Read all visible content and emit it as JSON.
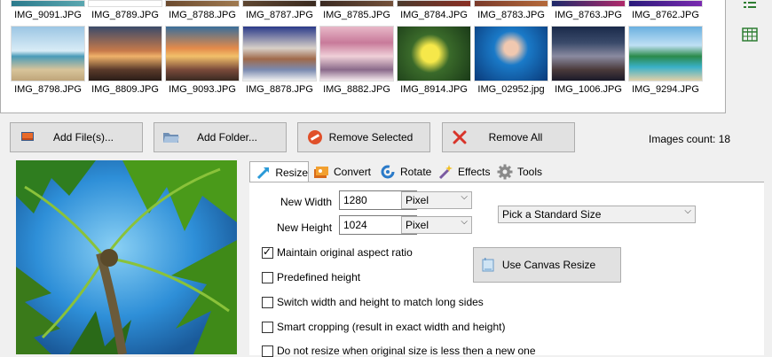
{
  "thumbnails_row1": [
    {
      "name": "IMG_9091.JPG"
    },
    {
      "name": "IMG_8789.JPG"
    },
    {
      "name": "IMG_8788.JPG"
    },
    {
      "name": "IMG_8787.JPG"
    },
    {
      "name": "IMG_8785.JPG"
    },
    {
      "name": "IMG_8784.JPG"
    },
    {
      "name": "IMG_8783.JPG"
    },
    {
      "name": "IMG_8763.JPG"
    },
    {
      "name": "IMG_8762.JPG"
    }
  ],
  "thumbnails_row2": [
    {
      "name": "IMG_8798.JPG"
    },
    {
      "name": "IMG_8809.JPG"
    },
    {
      "name": "IMG_9093.JPG"
    },
    {
      "name": "IMG_8878.JPG"
    },
    {
      "name": "IMG_8882.JPG"
    },
    {
      "name": "IMG_8914.JPG"
    },
    {
      "name": "IMG_02952.jpg"
    },
    {
      "name": "IMG_1006.JPG"
    },
    {
      "name": "IMG_9294.JPG"
    }
  ],
  "toolbar": {
    "add_files": "Add File(s)...",
    "add_folder": "Add Folder...",
    "remove_selected": "Remove Selected",
    "remove_all": "Remove All",
    "images_count": "Images count: 18"
  },
  "tabs": {
    "resize": "Resize",
    "convert": "Convert",
    "rotate": "Rotate",
    "effects": "Effects",
    "tools": "Tools"
  },
  "resize": {
    "new_width_label": "New Width",
    "new_width_value": "1280",
    "new_width_unit": "Pixel",
    "new_height_label": "New Height",
    "new_height_value": "1024",
    "new_height_unit": "Pixel",
    "standard_size": "Pick a Standard Size",
    "use_canvas_resize": "Use Canvas Resize",
    "opt_aspect": "Maintain original aspect ratio",
    "opt_predefined": "Predefined height",
    "opt_switch": "Switch width and height to match long sides",
    "opt_smart": "Smart cropping (result in exact width and height)",
    "opt_noresize": "Do not resize when original size is less then a new one"
  }
}
